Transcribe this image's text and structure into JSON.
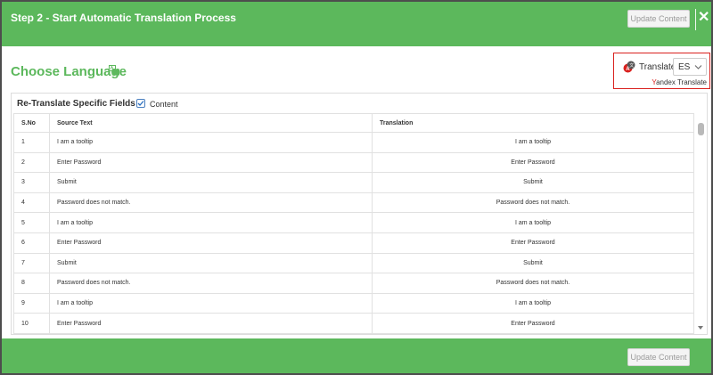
{
  "header": {
    "title": "Step 2 - Start Automatic Translation Process",
    "update_label": "Update Content",
    "close_glyph": "✕"
  },
  "section": {
    "title": "Choose Language"
  },
  "translate_widget": {
    "label": "Translate",
    "selected_language": "ES",
    "provider_initial": "Y",
    "provider_rest": "andex Translate"
  },
  "retranslate": {
    "label": "Re-Translate Specific Fields :",
    "checkbox_label": "Content",
    "checked": true
  },
  "table": {
    "headers": [
      "S.No",
      "Source Text",
      "Translation"
    ],
    "rows": [
      {
        "no": "1",
        "source": "I am a tooltip",
        "translation": "I am a tooltip"
      },
      {
        "no": "2",
        "source": "Enter Password",
        "translation": "Enter Password"
      },
      {
        "no": "3",
        "source": "Submit",
        "translation": "Submit"
      },
      {
        "no": "4",
        "source": "Password does not match.",
        "translation": "Password does not match."
      },
      {
        "no": "5",
        "source": "I am a tooltip",
        "translation": "I am a tooltip"
      },
      {
        "no": "6",
        "source": "Enter Password",
        "translation": "Enter Password"
      },
      {
        "no": "7",
        "source": "Submit",
        "translation": "Submit"
      },
      {
        "no": "8",
        "source": "Password does not match.",
        "translation": "Password does not match."
      },
      {
        "no": "9",
        "source": "I am a tooltip",
        "translation": "I am a tooltip"
      },
      {
        "no": "10",
        "source": "Enter Password",
        "translation": "Enter Password"
      }
    ]
  },
  "footer": {
    "update_label": "Update Content"
  },
  "colors": {
    "header_green": "#5cb85c",
    "title_green": "#5cb85c",
    "highlight_red": "#d9211e",
    "disabled_text": "#9a9a9a"
  }
}
